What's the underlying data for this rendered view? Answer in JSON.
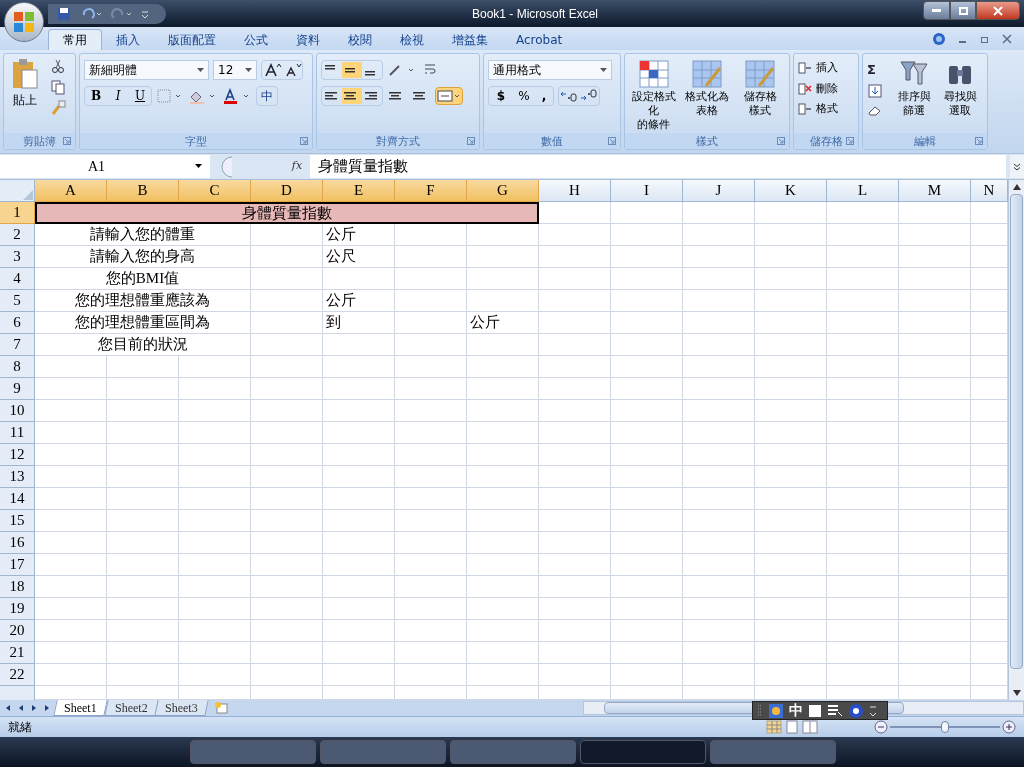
{
  "window": {
    "title": "Book1 - Microsoft Excel"
  },
  "ribbon_tabs": [
    {
      "label": "常用",
      "selected": true
    },
    {
      "label": "插入",
      "selected": false
    },
    {
      "label": "版面配置",
      "selected": false
    },
    {
      "label": "公式",
      "selected": false
    },
    {
      "label": "資料",
      "selected": false
    },
    {
      "label": "校閱",
      "selected": false
    },
    {
      "label": "檢視",
      "selected": false
    },
    {
      "label": "增益集",
      "selected": false
    },
    {
      "label": "Acrobat",
      "selected": false
    }
  ],
  "clipboard": {
    "paste": "貼上",
    "label": "剪貼簿"
  },
  "font": {
    "name": "新細明體",
    "size": "12",
    "bold": "B",
    "italic": "I",
    "underline": "U",
    "phonetic": "中",
    "label": "字型"
  },
  "alignment": {
    "label": "對齊方式"
  },
  "number": {
    "format": "通用格式",
    "currency": "$",
    "percent": "%",
    "comma": ",",
    "label": "數值"
  },
  "styles": {
    "buttons": [
      [
        "設定格式化",
        "的條件"
      ],
      [
        "格式化為",
        "表格"
      ],
      [
        "儲存格",
        "樣式"
      ]
    ],
    "label": "樣式"
  },
  "cells": {
    "buttons": [
      "插入",
      "刪除",
      "格式"
    ],
    "label": "儲存格"
  },
  "editing": {
    "sigma": "Σ",
    "buttons": [
      [
        "排序與",
        "篩選"
      ],
      [
        "尋找與",
        "選取"
      ]
    ],
    "label": "編輯"
  },
  "formula_bar": {
    "name_box": "A1",
    "fx": "fx",
    "value": "身體質量指數"
  },
  "columns": [
    {
      "label": "A",
      "selected": true
    },
    {
      "label": "B",
      "selected": true
    },
    {
      "label": "C",
      "selected": true
    },
    {
      "label": "D",
      "selected": true
    },
    {
      "label": "E",
      "selected": true
    },
    {
      "label": "F",
      "selected": true
    },
    {
      "label": "G",
      "selected": true
    },
    {
      "label": "H",
      "selected": false
    },
    {
      "label": "I",
      "selected": false
    },
    {
      "label": "J",
      "selected": false
    },
    {
      "label": "K",
      "selected": false
    },
    {
      "label": "L",
      "selected": false
    },
    {
      "label": "M",
      "selected": false
    },
    {
      "label": "N",
      "selected": false
    }
  ],
  "rows": [
    {
      "number": "1",
      "selected": true,
      "kind": "title",
      "title": "身體質量指數"
    },
    {
      "number": "2",
      "selected": false,
      "kind": "data",
      "label": "請輸入您的體重",
      "unit": "公斤"
    },
    {
      "number": "3",
      "selected": false,
      "kind": "data",
      "label": "請輸入您的身高",
      "unit": "公尺"
    },
    {
      "number": "4",
      "selected": false,
      "kind": "data",
      "label": "您的BMI值"
    },
    {
      "number": "5",
      "selected": false,
      "kind": "data",
      "label": "您的理想體重應該為",
      "unit": "公斤"
    },
    {
      "number": "6",
      "selected": false,
      "kind": "data",
      "label": "您的理想體重區間為",
      "unit": "到",
      "unit_2": "公斤"
    },
    {
      "number": "7",
      "selected": false,
      "kind": "data",
      "label": "您目前的狀況"
    },
    {
      "number": "8",
      "selected": false,
      "kind": "data"
    },
    {
      "number": "9",
      "selected": false,
      "kind": "data"
    },
    {
      "number": "10",
      "selected": false,
      "kind": "data"
    },
    {
      "number": "11",
      "selected": false,
      "kind": "data"
    },
    {
      "number": "12",
      "selected": false,
      "kind": "data"
    },
    {
      "number": "13",
      "selected": false,
      "kind": "data"
    },
    {
      "number": "14",
      "selected": false,
      "kind": "data"
    },
    {
      "number": "15",
      "selected": false,
      "kind": "data"
    },
    {
      "number": "16",
      "selected": false,
      "kind": "data"
    },
    {
      "number": "17",
      "selected": false,
      "kind": "data"
    },
    {
      "number": "18",
      "selected": false,
      "kind": "data"
    },
    {
      "number": "19",
      "selected": false,
      "kind": "data"
    },
    {
      "number": "20",
      "selected": false,
      "kind": "data"
    },
    {
      "number": "21",
      "selected": false,
      "kind": "data"
    },
    {
      "number": "22",
      "selected": false,
      "kind": "data"
    }
  ],
  "sheets": [
    {
      "label": "Sheet1",
      "selected": true
    },
    {
      "label": "Sheet2",
      "selected": false
    },
    {
      "label": "Sheet3",
      "selected": false
    }
  ],
  "ime_bar": {
    "mode": "中"
  },
  "status_bar": {
    "text": "就緒",
    "zoom": {
      "level": 0.5
    }
  }
}
